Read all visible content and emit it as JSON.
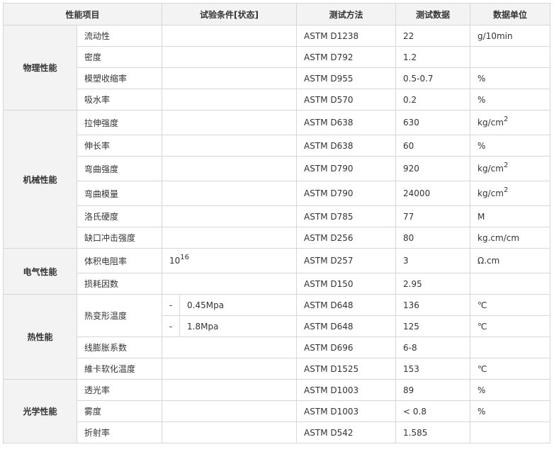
{
  "headers": {
    "property": "性能项目",
    "condition": "试验条件[状态]",
    "method": "测试方法",
    "value": "测试数据",
    "unit": "数据单位"
  },
  "groups": {
    "physical": "物理性能",
    "mechanical": "机械性能",
    "electrical": "电气性能",
    "thermal": "热性能",
    "optical": "光学性能"
  },
  "rows": [
    {
      "name": "流动性",
      "cond": "",
      "method": "ASTM D1238",
      "value": "22",
      "unit": "g/10min"
    },
    {
      "name": "密度",
      "cond": "",
      "method": "ASTM D792",
      "value": "1.2",
      "unit": ""
    },
    {
      "name": "模塑收缩率",
      "cond": "",
      "method": "ASTM D955",
      "value": "0.5-0.7",
      "unit": "%"
    },
    {
      "name": "吸水率",
      "cond": "",
      "method": "ASTM D570",
      "value": "0.2",
      "unit": "%"
    },
    {
      "name": "拉伸强度",
      "cond": "",
      "method": "ASTM D638",
      "value": "630",
      "unit": "kg/cm",
      "unit_sup": "2"
    },
    {
      "name": "伸长率",
      "cond": "",
      "method": "ASTM D638",
      "value": "60",
      "unit": "%"
    },
    {
      "name": "弯曲强度",
      "cond": "",
      "method": "ASTM D790",
      "value": "920",
      "unit": "kg/cm",
      "unit_sup": "2"
    },
    {
      "name": "弯曲模量",
      "cond": "",
      "method": "ASTM D790",
      "value": "24000",
      "unit": "kg/cm",
      "unit_sup": "2"
    },
    {
      "name": "洛氏硬度",
      "cond": "",
      "method": "ASTM D785",
      "value": "77",
      "unit": "M"
    },
    {
      "name": "缺口冲击强度",
      "cond": "",
      "method": "ASTM D256",
      "value": "80",
      "unit": "kg.cm/cm"
    },
    {
      "name": "体积电阻率",
      "cond": "10",
      "cond_sup": "16",
      "method": "ASTM D257",
      "value": "3",
      "unit": "Ω.cm"
    },
    {
      "name": "损耗因数",
      "cond": "",
      "method": "ASTM D150",
      "value": "2.95",
      "unit": ""
    },
    {
      "name": "热变形温度",
      "dash": "-",
      "cond": "0.45Mpa",
      "method": "ASTM D648",
      "value": "136",
      "unit": "℃"
    },
    {
      "dash": "-",
      "cond": "1.8Mpa",
      "method": "ASTM D648",
      "value": "125",
      "unit": "℃"
    },
    {
      "name": "线膨胀系数",
      "cond": "",
      "method": "ASTM D696",
      "value": "6-8",
      "unit": ""
    },
    {
      "name": "維卡软化温度",
      "cond": "",
      "method": "ASTM D1525",
      "value": "153",
      "unit": "℃"
    },
    {
      "name": "透光率",
      "cond": "",
      "method": "ASTM D1003",
      "value": "89",
      "unit": "%"
    },
    {
      "name": "雾度",
      "cond": "",
      "method": "ASTM D1003",
      "value": "< 0.8",
      "unit": "%"
    },
    {
      "name": "折射率",
      "cond": "",
      "method": "ASTM D542",
      "value": "1.585",
      "unit": ""
    }
  ]
}
